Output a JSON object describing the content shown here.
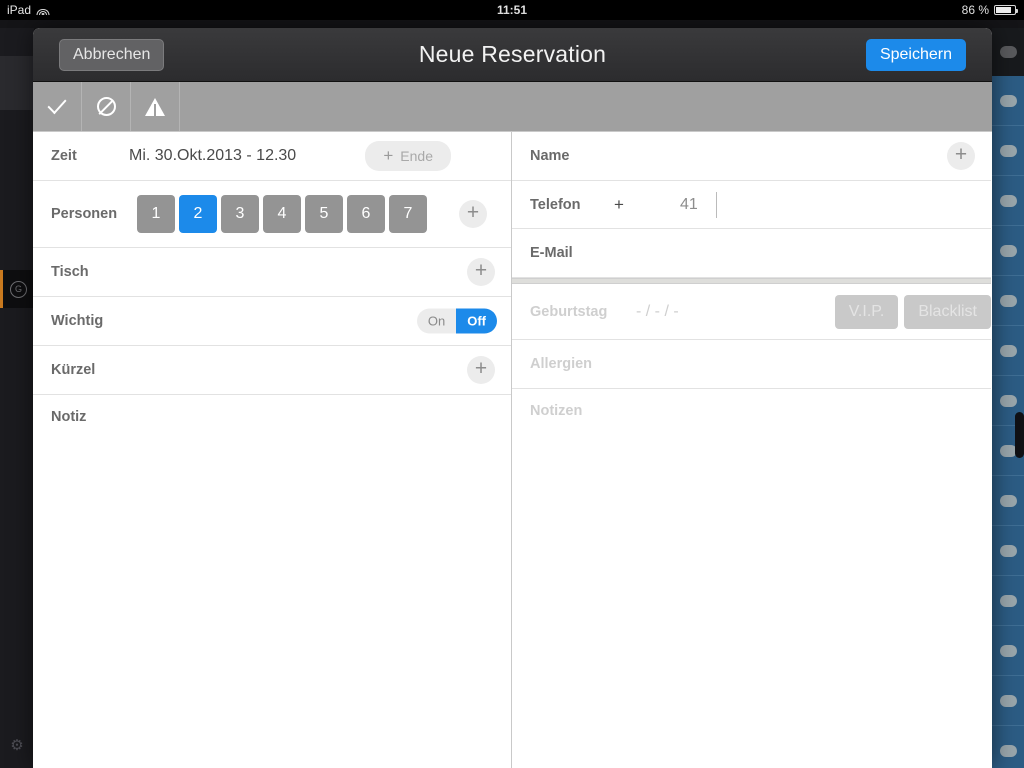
{
  "statusbar": {
    "device": "iPad",
    "wifi_icon": "wifi-icon",
    "time": "11:51",
    "battery_percent": "86 %",
    "battery_icon": "battery-icon"
  },
  "navbar": {
    "cancel_label": "Abbrechen",
    "title": "Neue Reservation",
    "save_label": "Speichern",
    "save_color": "#1c8aea"
  },
  "toolbar": {
    "items": [
      {
        "icon": "check-icon",
        "name": "status-confirmed"
      },
      {
        "icon": "ban-icon",
        "name": "status-cancelled"
      },
      {
        "icon": "warning-icon",
        "name": "status-warning"
      }
    ]
  },
  "left_column": {
    "zeit": {
      "label": "Zeit",
      "value": "Mi. 30.Okt.2013 - 12.30",
      "end_button": {
        "plus": "+",
        "label": "Ende"
      }
    },
    "personen": {
      "label": "Personen",
      "options": [
        "1",
        "2",
        "3",
        "4",
        "5",
        "6",
        "7"
      ],
      "selected": "2",
      "selected_color": "#1c8aea",
      "add_label": "+"
    },
    "tisch": {
      "label": "Tisch",
      "add_label": "+"
    },
    "wichtig": {
      "label": "Wichtig",
      "on_label": "On",
      "off_label": "Off",
      "selected": "Off"
    },
    "kuerzel": {
      "label": "Kürzel",
      "add_label": "+"
    },
    "notiz": {
      "label": "Notiz",
      "value": ""
    }
  },
  "right_column": {
    "name": {
      "label": "Name",
      "value": "",
      "add_label": "+"
    },
    "telefon": {
      "label": "Telefon",
      "plus": "+",
      "country_code": "41",
      "value": ""
    },
    "email": {
      "label": "E-Mail",
      "value": ""
    },
    "geburtstag": {
      "label": "Geburtstag",
      "value": "- / - / -",
      "vip_label": "V.I.P.",
      "blacklist_label": "Blacklist",
      "disabled": true
    },
    "allergien": {
      "label": "Allergien",
      "value": ""
    },
    "notizen": {
      "label": "Notizen",
      "value": ""
    }
  },
  "background": {
    "sidebar_active_accent": "#c8791f",
    "sidebar_icon": "circle-g-icon",
    "settings_icon": "gear-icon",
    "list_color": "#2c5c84"
  }
}
